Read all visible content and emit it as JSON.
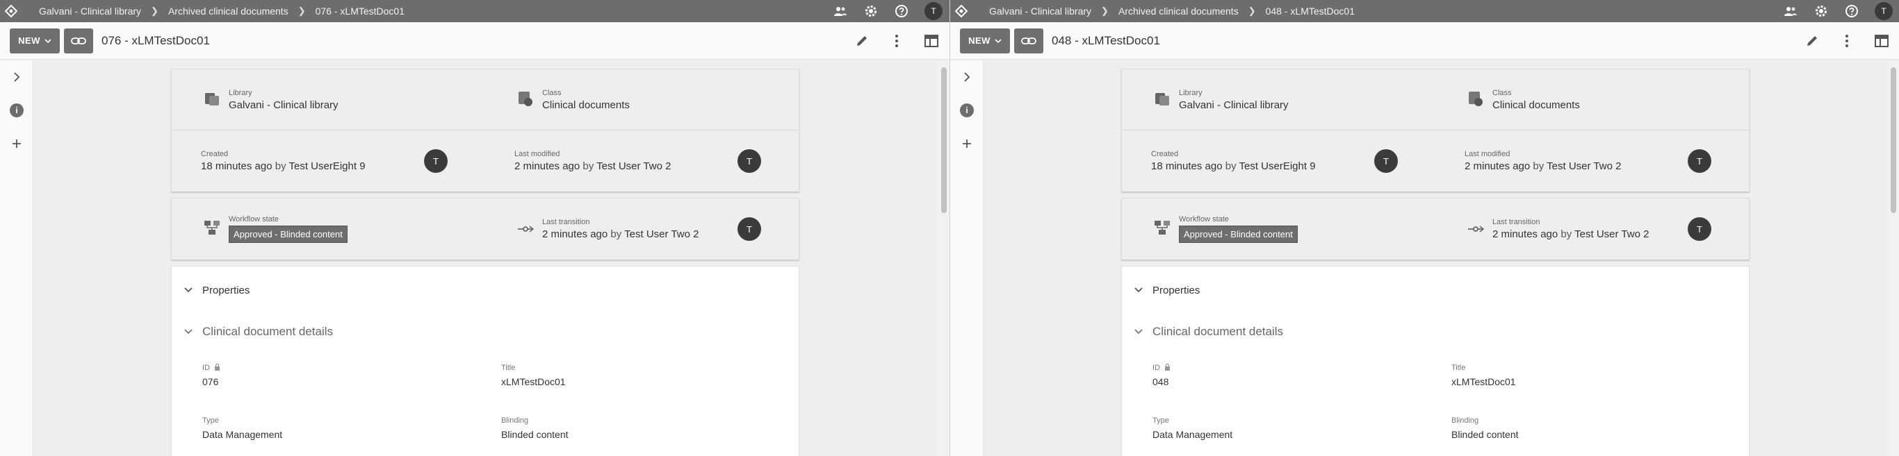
{
  "colors": {
    "topbar": "#6d6d6d",
    "toolbar": "#fafafa",
    "avatar": "#3b3b3b",
    "chip": "#6e6e6e"
  },
  "panes": [
    {
      "breadcrumb": [
        "Galvani - Clinical library",
        "Archived clinical documents",
        "076 - xLMTestDoc01"
      ],
      "toolbar": {
        "new_label": "NEW",
        "doc_title": "076 - xLMTestDoc01"
      },
      "summary": {
        "library_label": "Library",
        "library_value": "Galvani - Clinical library",
        "class_label": "Class",
        "class_value": "Clinical documents",
        "created_label": "Created",
        "created_time": "18 minutes ago",
        "created_by_word": "by",
        "created_user": "Test UserEight 9",
        "modified_label": "Last modified",
        "modified_time": "2 minutes ago",
        "modified_by_word": "by",
        "modified_user": "Test User Two 2",
        "workflow_label": "Workflow state",
        "workflow_value": "Approved - Blinded content",
        "transition_label": "Last transition",
        "transition_time": "2 minutes ago",
        "transition_by_word": "by",
        "transition_user": "Test User Two 2",
        "avatar_created": "T",
        "avatar_modified": "T",
        "avatar_transition": "T"
      },
      "properties_title": "Properties",
      "details_title": "Clinical document details",
      "fields": [
        {
          "label": "ID",
          "value": "076"
        },
        {
          "label": "Title",
          "value": "xLMTestDoc01"
        },
        {
          "label": "Type",
          "value": "Data Management"
        },
        {
          "label": "Blinding",
          "value": "Blinded content"
        }
      ]
    },
    {
      "breadcrumb": [
        "Galvani - Clinical library",
        "Archived clinical documents",
        "048 - xLMTestDoc01"
      ],
      "toolbar": {
        "new_label": "NEW",
        "doc_title": "048 - xLMTestDoc01"
      },
      "summary": {
        "library_label": "Library",
        "library_value": "Galvani - Clinical library",
        "class_label": "Class",
        "class_value": "Clinical documents",
        "created_label": "Created",
        "created_time": "18 minutes ago",
        "created_by_word": "by",
        "created_user": "Test UserEight 9",
        "modified_label": "Last modified",
        "modified_time": "2 minutes ago",
        "modified_by_word": "by",
        "modified_user": "Test User Two 2",
        "workflow_label": "Workflow state",
        "workflow_value": "Approved - Blinded content",
        "transition_label": "Last transition",
        "transition_time": "2 minutes ago",
        "transition_by_word": "by",
        "transition_user": "Test User Two 2",
        "avatar_created": "T",
        "avatar_modified": "T",
        "avatar_transition": "T"
      },
      "properties_title": "Properties",
      "details_title": "Clinical document details",
      "fields": [
        {
          "label": "ID",
          "value": "048"
        },
        {
          "label": "Title",
          "value": "xLMTestDoc01"
        },
        {
          "label": "Type",
          "value": "Data Management"
        },
        {
          "label": "Blinding",
          "value": "Blinded content"
        }
      ]
    }
  ]
}
